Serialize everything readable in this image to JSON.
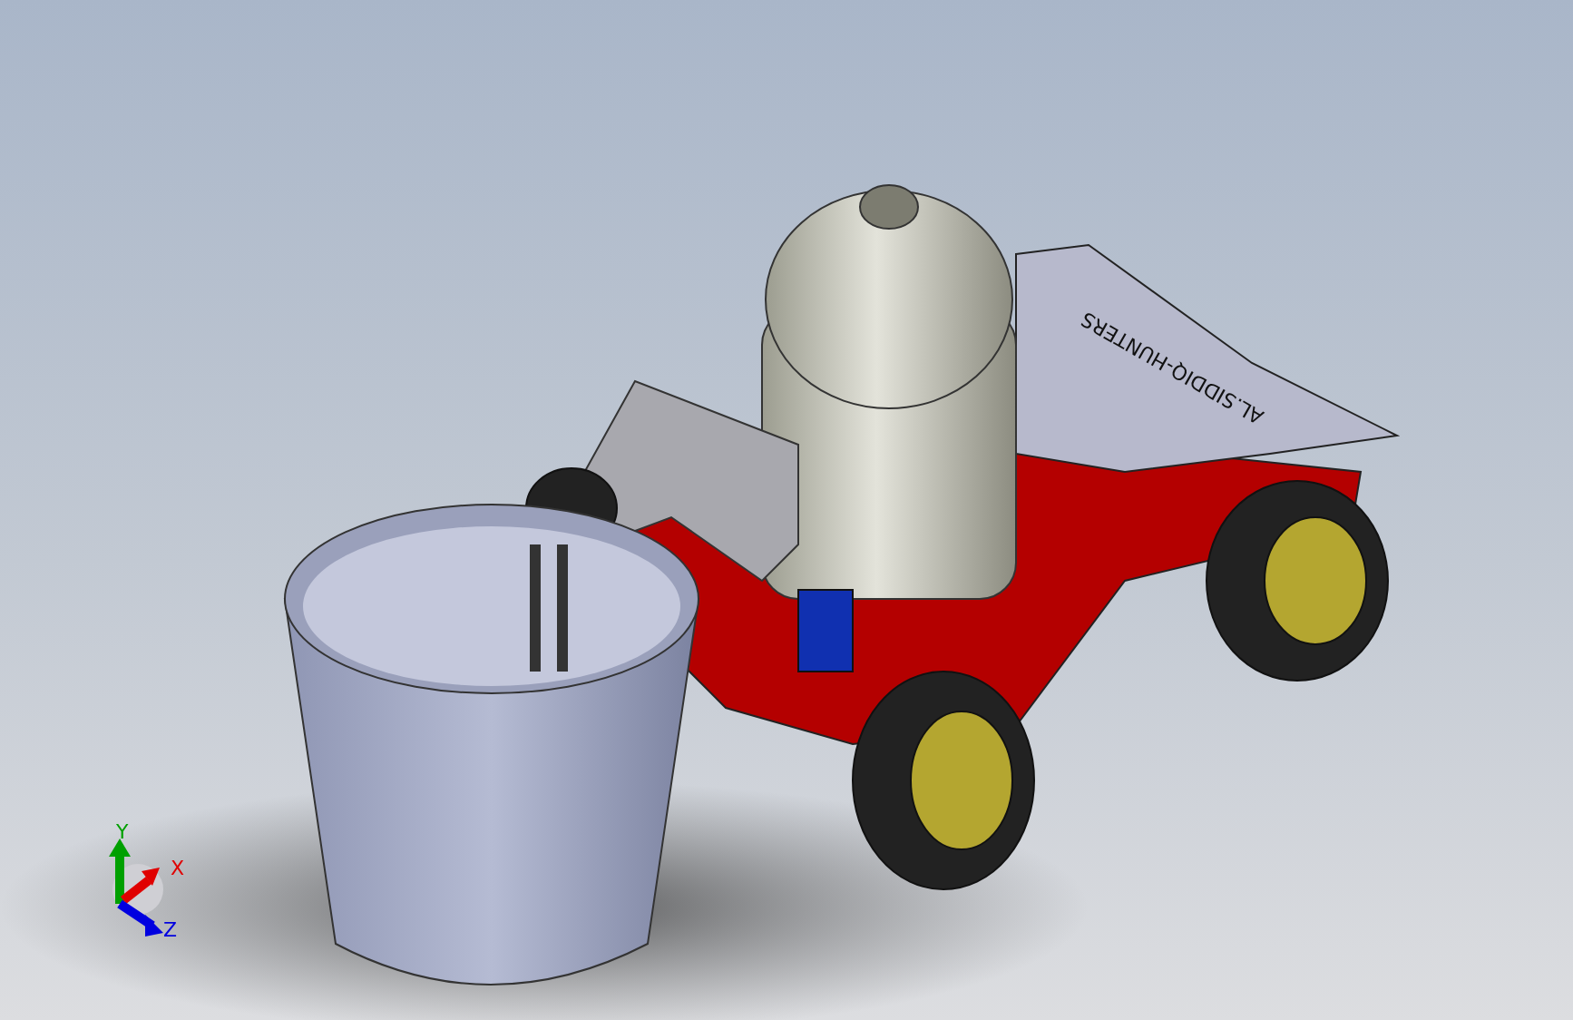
{
  "model": {
    "engraving": "AL.SIDDIQ-HUNTERS"
  },
  "triad": {
    "axes": [
      {
        "label": "Y",
        "color": "#00a000"
      },
      {
        "label": "X",
        "color": "#e00000"
      },
      {
        "label": "Z",
        "color": "#0000e0"
      }
    ]
  }
}
